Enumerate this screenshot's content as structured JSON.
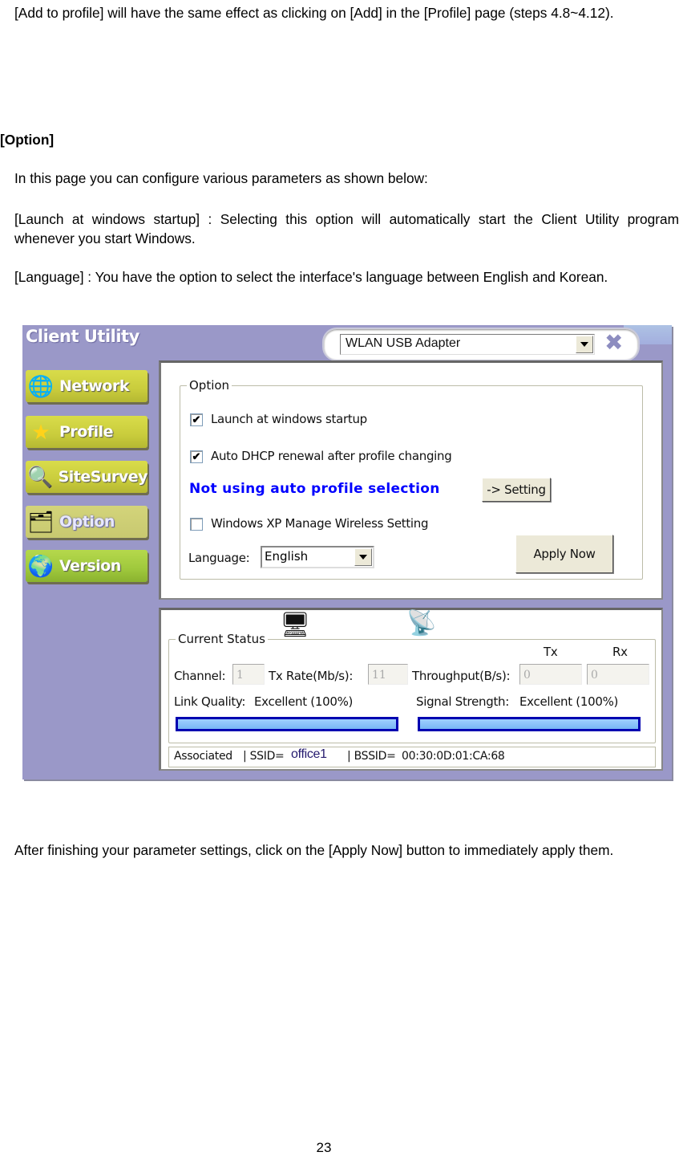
{
  "doc": {
    "intro_paragraph": "[Add to profile] will have the same effect as clicking on [Add] in the [Profile] page (steps 4.8~4.12).",
    "section_heading": "[Option]",
    "paragraphs": [
      "In this page you can configure various parameters as shown below:",
      "[Launch at windows startup] : Selecting this option will automatically start the Client Utility program whenever you start Windows.",
      "[Language] : You have the option to select the interface's language between English and Korean."
    ],
    "closing_paragraph": "After finishing your parameter settings, click on the [Apply Now] button to immediately apply them.",
    "page_number": "23"
  },
  "app": {
    "title": "Client Utility",
    "adapter": {
      "selected": "WLAN USB Adapter",
      "icon": "chevron-down-icon"
    },
    "close_icon": "close-icon",
    "nav": [
      {
        "label": "Network",
        "icon": "globe-network-icon",
        "active": false
      },
      {
        "label": "Profile",
        "icon": "star-icon",
        "active": false
      },
      {
        "label": "SiteSurvey",
        "icon": "magnifier-icon",
        "active": false
      },
      {
        "label": "Option",
        "icon": "folder-settings-icon",
        "active": true
      },
      {
        "label": "Version",
        "icon": "globe-icon",
        "active": false
      }
    ],
    "option": {
      "group_label": "Option",
      "launch_startup": {
        "label": "Launch at windows startup",
        "checked": true
      },
      "auto_dhcp": {
        "label": "Auto DHCP renewal after profile changing",
        "checked": true
      },
      "auto_profile_status": "Not using auto profile selection",
      "auto_profile_color": "#0000ff",
      "setting_button": "-> Setting",
      "xp_manage": {
        "label": "Windows XP Manage Wireless Setting",
        "checked": false
      },
      "language_label": "Language:",
      "language_value": "English",
      "apply_button": "Apply Now"
    },
    "status": {
      "group_label": "Current Status",
      "channel_label": "Channel:",
      "channel_value": "1",
      "tx_rate_label": "Tx Rate(Mb/s):",
      "tx_rate_value": "11",
      "throughput_label": "Throughput(B/s):",
      "tx_header": "Tx",
      "rx_header": "Rx",
      "throughput_tx": "0",
      "throughput_rx": "0",
      "link_quality_label": "Link Quality:",
      "link_quality_value": "Excellent (100%)",
      "link_quality_percent": 100,
      "signal_strength_label": "Signal Strength:",
      "signal_strength_value": "Excellent (100%)",
      "signal_strength_percent": 100,
      "statusbar": {
        "state": "Associated",
        "ssid_label": "| SSID=",
        "ssid_value": "office1",
        "bssid_label": "| BSSID=",
        "bssid_value": "00:30:0D:01:CA:68"
      }
    }
  }
}
